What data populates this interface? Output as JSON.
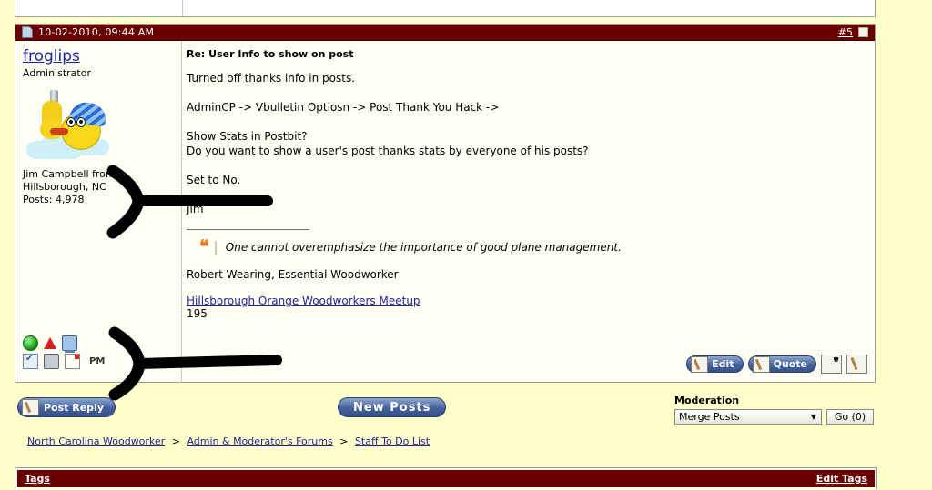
{
  "theme": {
    "header_bar": "#6B0000",
    "page_background": "#FFFFCC",
    "post_background": "#FFFFF5",
    "link_color": "#22229C",
    "button_blue": "#44619E",
    "quote_accent": "#E07A26"
  },
  "post": {
    "date": "10-02-2010, 09:44 AM",
    "post_number": "#5",
    "doc_icon": "post-document-icon",
    "view_icon": "square-icon",
    "user": {
      "name": "froglips",
      "title": "Administrator",
      "avatar_alt": "yellow-character-with-blue-hat-avatar",
      "real_name_location": "Jim Campbell from",
      "location": "Hillsborough, NC",
      "posts": "Posts: 4,978"
    },
    "status_icons": [
      {
        "name": "online-indicator-icon",
        "label": "Online"
      },
      {
        "name": "warning-triangle-icon",
        "label": "Report Post"
      },
      {
        "name": "computer-icon",
        "label": "IP Address"
      },
      {
        "name": "checkbox-icon",
        "label": "Select Post"
      },
      {
        "name": "printer-icon",
        "label": "Print"
      },
      {
        "name": "page-flag-icon",
        "label": "Flag"
      }
    ],
    "pm_label": "PM",
    "title": "Re: User Info to show on post",
    "body": [
      "Turned off thanks info in posts.",
      "AdminCP -> Vbulletin Optiosn -> Post Thank You Hack ->",
      "Show Stats in Postbit?",
      "Do you want to show a user's post thanks stats by everyone of his posts?",
      "Set to No.",
      "Jim"
    ],
    "signature": {
      "quote": "One cannot overemphasize the importance of good plane management.",
      "attribution": "Robert Wearing, Essential Woodworker",
      "link": "Hillsborough Orange Woodworkers Meetup",
      "number": "195"
    },
    "actions": [
      {
        "name": "edit-button",
        "label": "Edit"
      },
      {
        "name": "quote-button",
        "label": "Quote"
      },
      {
        "name": "multiquote-button",
        "label": ""
      },
      {
        "name": "quickreply-button",
        "label": ""
      }
    ]
  },
  "toolbar": {
    "post_reply_label": "Post Reply",
    "new_posts_label": "New Posts",
    "moderation_title": "Moderation",
    "moderation_selected": "Merge Posts",
    "moderation_go": "Go (0)"
  },
  "breadcrumb": [
    "North Carolina Woodworker",
    "Admin & Moderator's Forums",
    "Staff To Do List"
  ],
  "breadcrumb_separator": ">",
  "tags": {
    "title": "Tags",
    "edit_label": "Edit Tags"
  }
}
